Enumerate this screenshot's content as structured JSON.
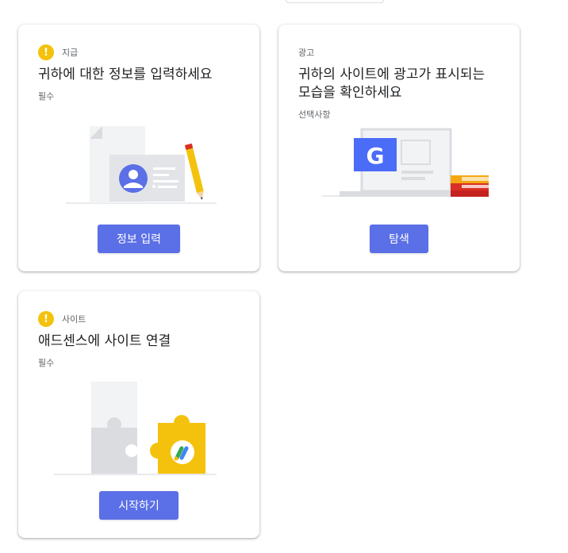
{
  "cards": [
    {
      "category": "지급",
      "title": "귀하에 대한 정보를 입력하세요",
      "requirement": "필수",
      "button": "정보 입력",
      "warning_icon": "exclamation-circle-icon"
    },
    {
      "category": "광고",
      "title_line1": "귀하의 사이트에 광고가 표시되는",
      "title_line2": "모습을 확인하세요",
      "requirement": "선택사항",
      "button": "탐색",
      "illustration_letter": "G"
    },
    {
      "category": "사이트",
      "title": "애드센스에 사이트 연결",
      "requirement": "필수",
      "button": "시작하기",
      "warning_icon": "exclamation-circle-icon"
    }
  ],
  "colors": {
    "accent_button": "#5b6fe6",
    "warning": "#f4c20d",
    "google_blue": "#4285f4",
    "adsense_yellow": "#f4c20d"
  }
}
